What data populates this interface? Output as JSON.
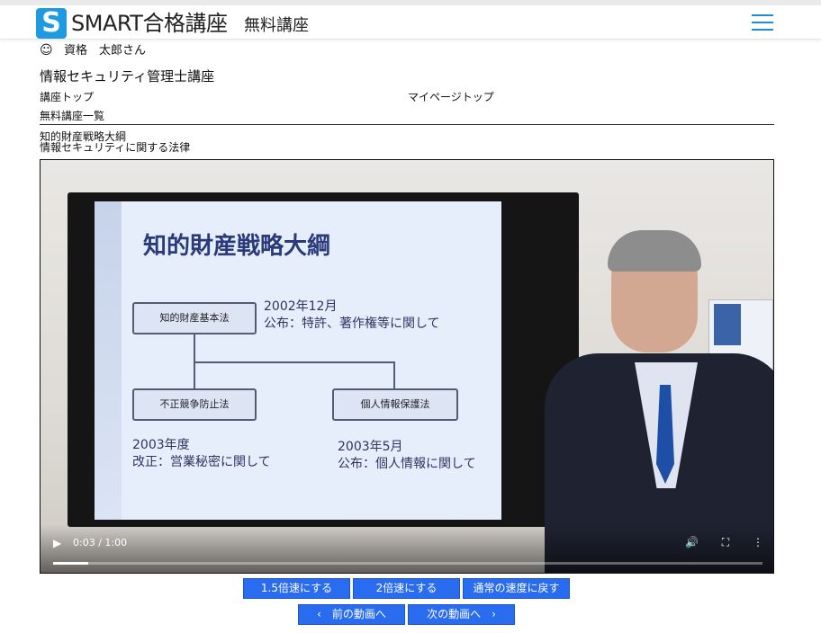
{
  "header": {
    "logo_letter": "S",
    "brand": "SMART合格講座",
    "brand_sub": "無料講座"
  },
  "user": {
    "icon": "☺",
    "name": "資格　太郎さん"
  },
  "course_title": "情報セキュリティ管理士講座",
  "nav": {
    "course_top": "講座トップ",
    "mypage_top": "マイページトップ",
    "free_list": "無料講座一覧"
  },
  "breadcrumb": {
    "chapter": "知的財産戦略大綱",
    "section": "情報セキュリティに関する法律"
  },
  "slide": {
    "title": "知的財産戦略大綱",
    "box1": "知的財産基本法",
    "box1_note_line1": "2002年12月",
    "box1_note_line2": "公布：特許、著作権等に関して",
    "box2": "不正競争防止法",
    "box2_note_line1": "2003年度",
    "box2_note_line2": "改正：営業秘密に関して",
    "box3": "個人情報保護法",
    "box3_note_line1": "2003年5月",
    "box3_note_line2": "公布：個人情報に関して"
  },
  "player": {
    "time": "0:03 / 1:00",
    "progress": 0.05,
    "play_icon": "▶",
    "volume_icon": "🔊",
    "fullscreen_icon": "⛶",
    "menu_icon": "⋮"
  },
  "buttons": {
    "speed_15": "1.5倍速にする",
    "speed_2": "2倍速にする",
    "speed_normal": "通常の速度に戻す",
    "prev": "‹　前の動画へ",
    "next": "次の動画へ　›"
  }
}
